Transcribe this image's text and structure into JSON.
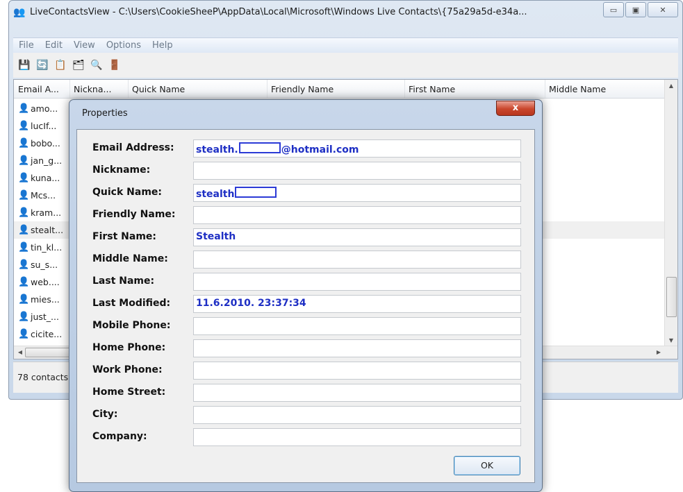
{
  "window": {
    "title": "LiveContactsView  -  C:\\Users\\CookieSheeP\\AppData\\Local\\Microsoft\\Windows Live Contacts\\{75a29a5d-e34a...",
    "buttons": {
      "minimize": "▭",
      "maximize": "▣",
      "close": "✕"
    }
  },
  "menu": [
    "File",
    "Edit",
    "View",
    "Options",
    "Help"
  ],
  "toolbar": {
    "icons": [
      "save-icon",
      "refresh-icon",
      "copy-icon",
      "properties-icon",
      "find-icon",
      "exit-icon"
    ],
    "glyphs": [
      "💾",
      "🔄",
      "📋",
      "🗂",
      "🔍",
      "🚪"
    ]
  },
  "list": {
    "columns": [
      "Email A...",
      "Nickna...",
      "Quick Name",
      "Friendly Name",
      "First Name",
      "Middle Name"
    ],
    "rows": [
      {
        "email": "amo...",
        "selected": false
      },
      {
        "email": "lucIf...",
        "selected": false
      },
      {
        "email": "bobo...",
        "selected": false
      },
      {
        "email": "jan_g...",
        "selected": false
      },
      {
        "email": "kuna...",
        "selected": false
      },
      {
        "email": "Mcs...",
        "selected": false
      },
      {
        "email": "kram...",
        "selected": false
      },
      {
        "email": "stealt...",
        "selected": true
      },
      {
        "email": "tin_kl...",
        "selected": false
      },
      {
        "email": "su_s...",
        "selected": false
      },
      {
        "email": "web....",
        "selected": false
      },
      {
        "email": "mies...",
        "selected": false
      },
      {
        "email": "just_...",
        "selected": false
      },
      {
        "email": "cicite...",
        "selected": false
      }
    ]
  },
  "status": {
    "text": "78 contacts,"
  },
  "dialog": {
    "title": "Properties",
    "close_label": "x",
    "fields": [
      {
        "label": "Email Address:",
        "value_prefix": "stealth.",
        "redacted": true,
        "value_suffix": "@hotmail.com"
      },
      {
        "label": "Nickname:",
        "value_prefix": "",
        "redacted": false,
        "value_suffix": ""
      },
      {
        "label": "Quick Name:",
        "value_prefix": "stealth",
        "redacted": true,
        "value_suffix": ""
      },
      {
        "label": "Friendly Name:",
        "value_prefix": "",
        "redacted": false,
        "value_suffix": ""
      },
      {
        "label": "First Name:",
        "value_prefix": "Stealth",
        "redacted": false,
        "value_suffix": ""
      },
      {
        "label": "Middle Name:",
        "value_prefix": "",
        "redacted": false,
        "value_suffix": ""
      },
      {
        "label": "Last Name:",
        "value_prefix": "",
        "redacted": false,
        "value_suffix": ""
      },
      {
        "label": "Last Modified:",
        "value_prefix": "11.6.2010. 23:37:34",
        "redacted": false,
        "value_suffix": ""
      },
      {
        "label": "Mobile Phone:",
        "value_prefix": "",
        "redacted": false,
        "value_suffix": ""
      },
      {
        "label": "Home Phone:",
        "value_prefix": "",
        "redacted": false,
        "value_suffix": ""
      },
      {
        "label": "Work Phone:",
        "value_prefix": "",
        "redacted": false,
        "value_suffix": ""
      },
      {
        "label": "Home Street:",
        "value_prefix": "",
        "redacted": false,
        "value_suffix": ""
      },
      {
        "label": "City:",
        "value_prefix": "",
        "redacted": false,
        "value_suffix": ""
      },
      {
        "label": "Company:",
        "value_prefix": "",
        "redacted": false,
        "value_suffix": ""
      }
    ],
    "ok_label": "OK"
  },
  "colors": {
    "value_text": "#1e2fc4",
    "close_button": "#c9462c",
    "contact_icon": "#3c8a2c"
  }
}
